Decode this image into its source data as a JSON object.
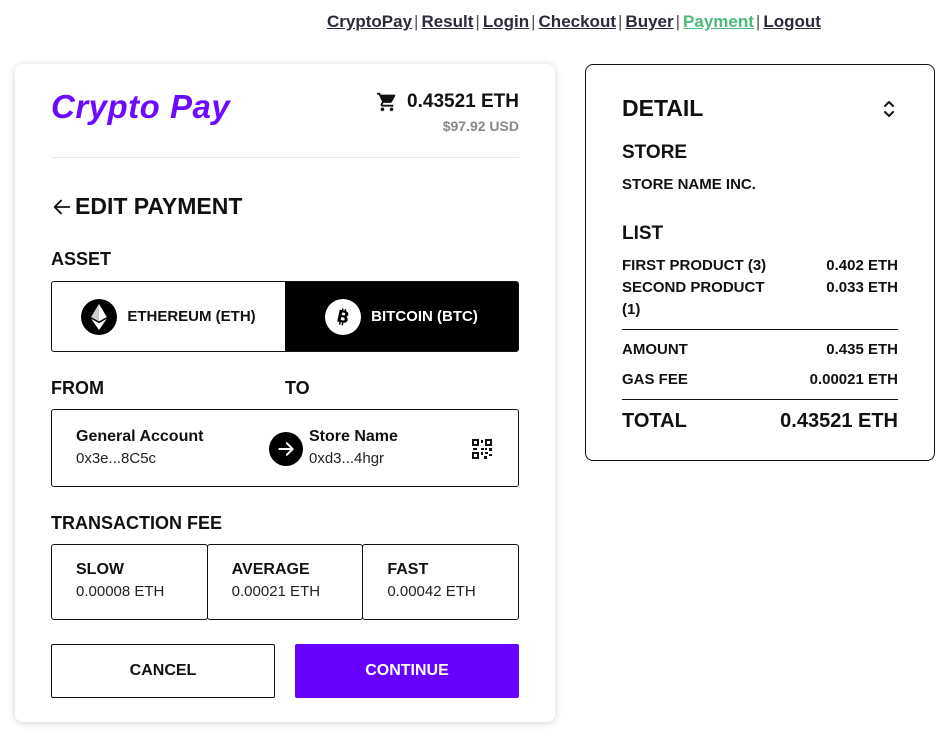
{
  "nav": {
    "items": [
      {
        "label": "CryptoPay"
      },
      {
        "label": "Result"
      },
      {
        "label": "Login"
      },
      {
        "label": "Checkout"
      },
      {
        "label": "Buyer"
      },
      {
        "label": "Payment"
      },
      {
        "label": "Logout"
      }
    ],
    "separator": "|",
    "active_color": "#4cba7a"
  },
  "payment": {
    "logo": "Crypto Pay",
    "price_eth": "0.43521 ETH",
    "price_usd": "$97.92 USD",
    "title": "EDIT PAYMENT",
    "asset_label": "ASSET",
    "assets": [
      {
        "label": "ETHEREUM (ETH)",
        "icon": "ethereum-icon",
        "selected": false
      },
      {
        "label": "BITCOIN (BTC)",
        "icon": "bitcoin-icon",
        "selected": true
      }
    ],
    "from_label": "FROM",
    "to_label": "TO",
    "from": {
      "name": "General Account",
      "address": "0x3e...8C5c"
    },
    "to": {
      "name": "Store Name",
      "address": "0xd3...4hgr"
    },
    "fee_label": "TRANSACTION FEE",
    "fees": [
      {
        "name": "SLOW",
        "value": "0.00008 ETH"
      },
      {
        "name": "AVERAGE",
        "value": "0.00021 ETH"
      },
      {
        "name": "FAST",
        "value": "0.00042 ETH"
      }
    ],
    "cancel_label": "CANCEL",
    "continue_label": "CONTINUE",
    "accent_color": "#6600ff"
  },
  "detail": {
    "title": "DETAIL",
    "store_heading": "STORE",
    "store_name": "STORE NAME INC.",
    "list_heading": "LIST",
    "items": [
      {
        "name": "FIRST PRODUCT (3)",
        "price": "0.402 ETH"
      },
      {
        "name": "SECOND PRODUCT (1)",
        "price": "0.033 ETH"
      }
    ],
    "amount_label": "AMOUNT",
    "amount_value": "0.435 ETH",
    "gas_label": "GAS FEE",
    "gas_value": "0.00021 ETH",
    "total_label": "TOTAL",
    "total_value": "0.43521 ETH"
  }
}
